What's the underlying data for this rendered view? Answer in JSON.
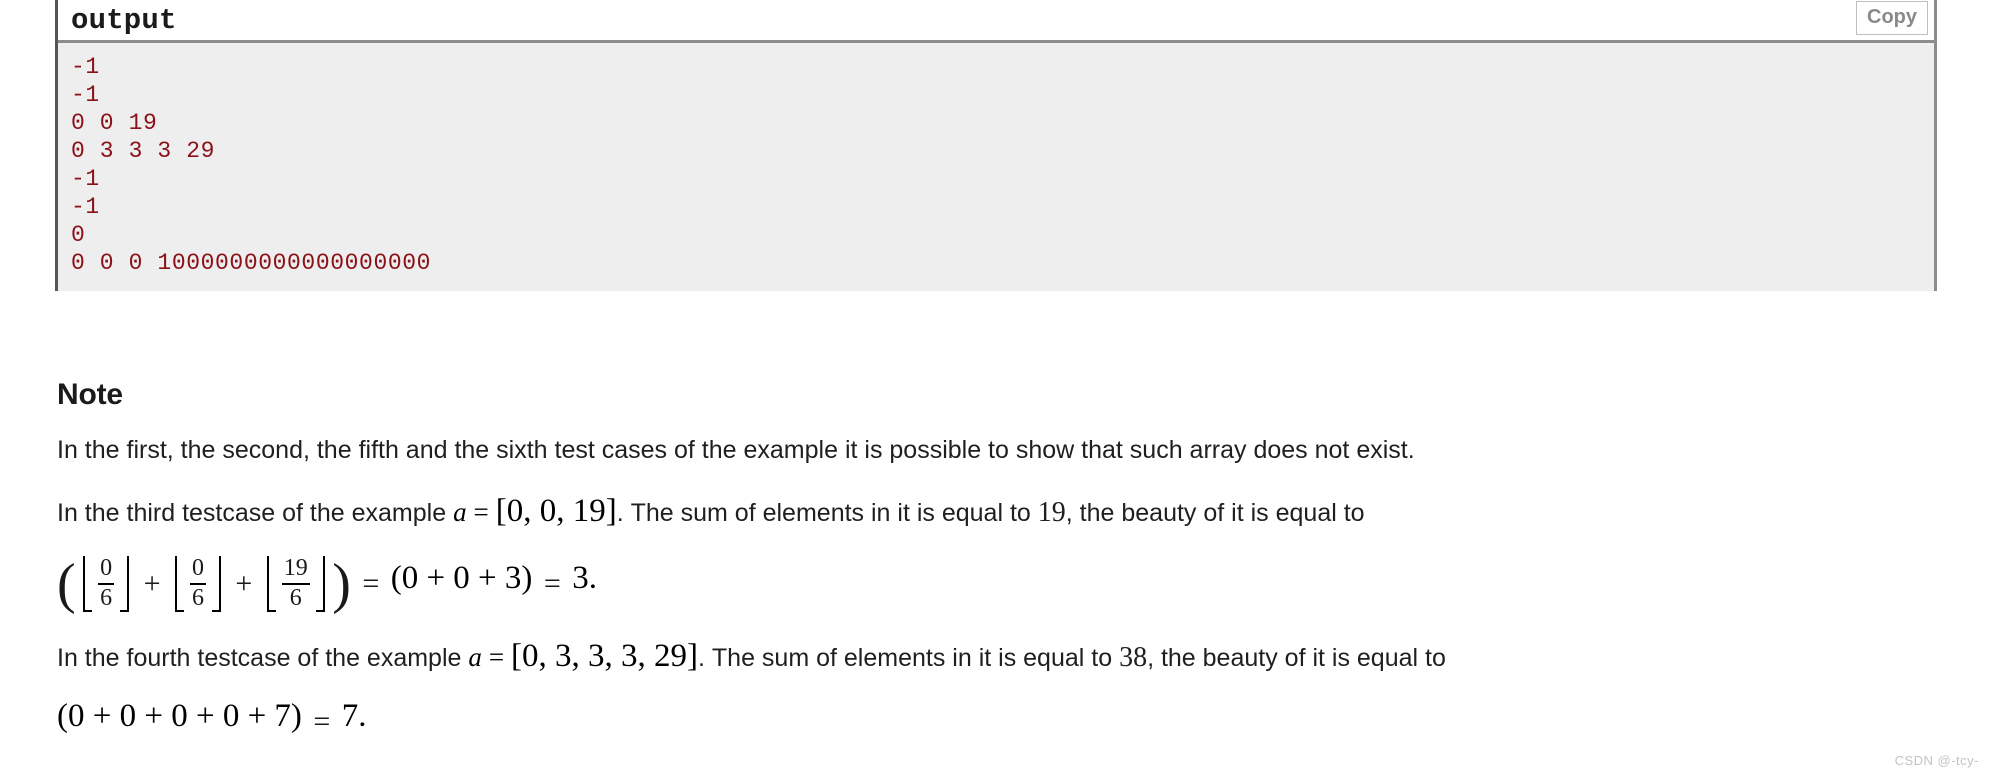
{
  "sample_test": {
    "title": "output",
    "copy_label": "Copy",
    "lines": [
      "-1",
      "-1",
      "0 0 19",
      "0 3 3 3 29",
      "-1",
      "-1",
      "0",
      "0 0 0 1000000000000000000"
    ],
    "text_color": "#8b1118",
    "body_background": "#eeeeee"
  },
  "note": {
    "heading": "Note",
    "paragraph1": "In the first, the second, the fifth and the sixth test cases of the example it is possible to show that such array does not exist.",
    "paragraph2": {
      "lead": "In the third testcase of the example",
      "var": "a",
      "equals": "=",
      "array": "[0, 0, 19]",
      "period": ".",
      "mid": "The sum of elements in it is equal to",
      "sum": "19",
      "tail": ", the beauty of it is equal to",
      "formula": {
        "terms": [
          {
            "num": "0",
            "den": "6"
          },
          {
            "num": "0",
            "den": "6"
          },
          {
            "num": "19",
            "den": "6"
          }
        ],
        "plus": "+",
        "equals": "=",
        "expansion": "(0 + 0 + 3)",
        "result": "3",
        "period": "."
      }
    },
    "paragraph3": {
      "lead": "In the fourth testcase of the example",
      "var": "a",
      "equals": "=",
      "array": "[0, 3, 3, 3, 29]",
      "period": ".",
      "mid": "The sum of elements in it is equal to",
      "sum": "38",
      "tail": ", the beauty of it is equal to",
      "formula": {
        "expansion": "(0 + 0 + 0 + 0 + 7)",
        "equals": "=",
        "result": "7",
        "period": "."
      }
    }
  },
  "watermark": "CSDN @-tcy-"
}
